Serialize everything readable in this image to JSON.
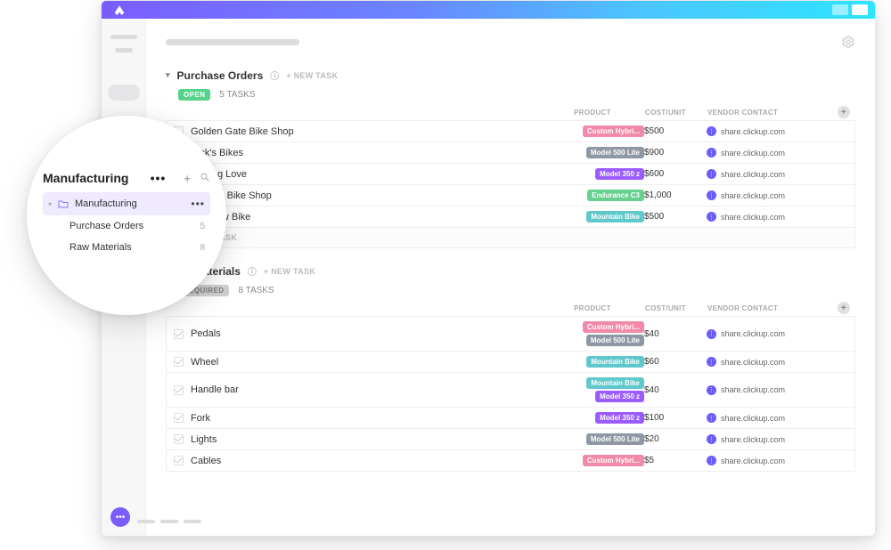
{
  "floating_panel": {
    "title": "Manufacturing",
    "folder_row": {
      "label": "Manufacturing"
    },
    "lists": [
      {
        "label": "Purchase Orders",
        "count": "5"
      },
      {
        "label": "Raw Materials",
        "count": "8"
      }
    ]
  },
  "list1": {
    "title": "Purchase Orders",
    "new_task_label": "+ NEW TASK",
    "status_label": "OPEN",
    "task_count_label": "5 TASKS",
    "cols": {
      "product": "PRODUCT",
      "cost": "COST/UNIT",
      "vendor": "VENDOR CONTACT"
    },
    "rows": [
      {
        "name": "Golden Gate Bike Shop",
        "tags": [
          {
            "label": "Custom Hybri...",
            "color": "c-pink"
          }
        ],
        "cost": "$500",
        "vendor": "share.clickup.com"
      },
      {
        "name": "Rick's Bikes",
        "tags": [
          {
            "label": "Model 500 Lite",
            "color": "c-grey"
          }
        ],
        "cost": "$900",
        "vendor": "share.clickup.com"
      },
      {
        "name": "Cycling Love",
        "tags": [
          {
            "label": "Model 350 z",
            "color": "c-purple"
          }
        ],
        "cost": "$600",
        "vendor": "share.clickup.com"
      },
      {
        "name": "Jenna's Bike Shop",
        "tags": [
          {
            "label": "Endurance C3",
            "color": "c-green"
          }
        ],
        "cost": "$1,000",
        "vendor": "share.clickup.com"
      },
      {
        "name": "Rainbow Bike",
        "tags": [
          {
            "label": "Mountain Bike",
            "color": "c-teal"
          }
        ],
        "cost": "$500",
        "vendor": "share.clickup.com"
      }
    ],
    "add_task_label": "+ ADD TASK"
  },
  "list2": {
    "title": "aw Materials",
    "full_title": "Raw Materials",
    "new_task_label": "+ NEW TASK",
    "status_label": "REQUIRED",
    "task_count_label": "8 TASKS",
    "cols": {
      "product": "PRODUCT",
      "cost": "COST/UNIT",
      "vendor": "VENDOR CONTACT"
    },
    "rows": [
      {
        "name": "Pedals",
        "tags": [
          {
            "label": "Custom Hybri...",
            "color": "c-pink"
          },
          {
            "label": "Model 500 Lite",
            "color": "c-grey"
          }
        ],
        "cost": "$40",
        "vendor": "share.clickup.com"
      },
      {
        "name": "Wheel",
        "tags": [
          {
            "label": "Mountain Bike",
            "color": "c-teal"
          }
        ],
        "cost": "$60",
        "vendor": "share.clickup.com"
      },
      {
        "name": "Handle bar",
        "tags": [
          {
            "label": "Mountain Bike",
            "color": "c-teal"
          },
          {
            "label": "Model 350 z",
            "color": "c-purple"
          }
        ],
        "cost": "$40",
        "vendor": "share.clickup.com"
      },
      {
        "name": "Fork",
        "tags": [
          {
            "label": "Model 350 z",
            "color": "c-purple"
          }
        ],
        "cost": "$100",
        "vendor": "share.clickup.com"
      },
      {
        "name": "Lights",
        "tags": [
          {
            "label": "Model 500 Lite",
            "color": "c-grey"
          }
        ],
        "cost": "$20",
        "vendor": "share.clickup.com"
      },
      {
        "name": "Cables",
        "tags": [
          {
            "label": "Custom Hybri...",
            "color": "c-pink"
          }
        ],
        "cost": "$5",
        "vendor": "share.clickup.com"
      }
    ]
  }
}
